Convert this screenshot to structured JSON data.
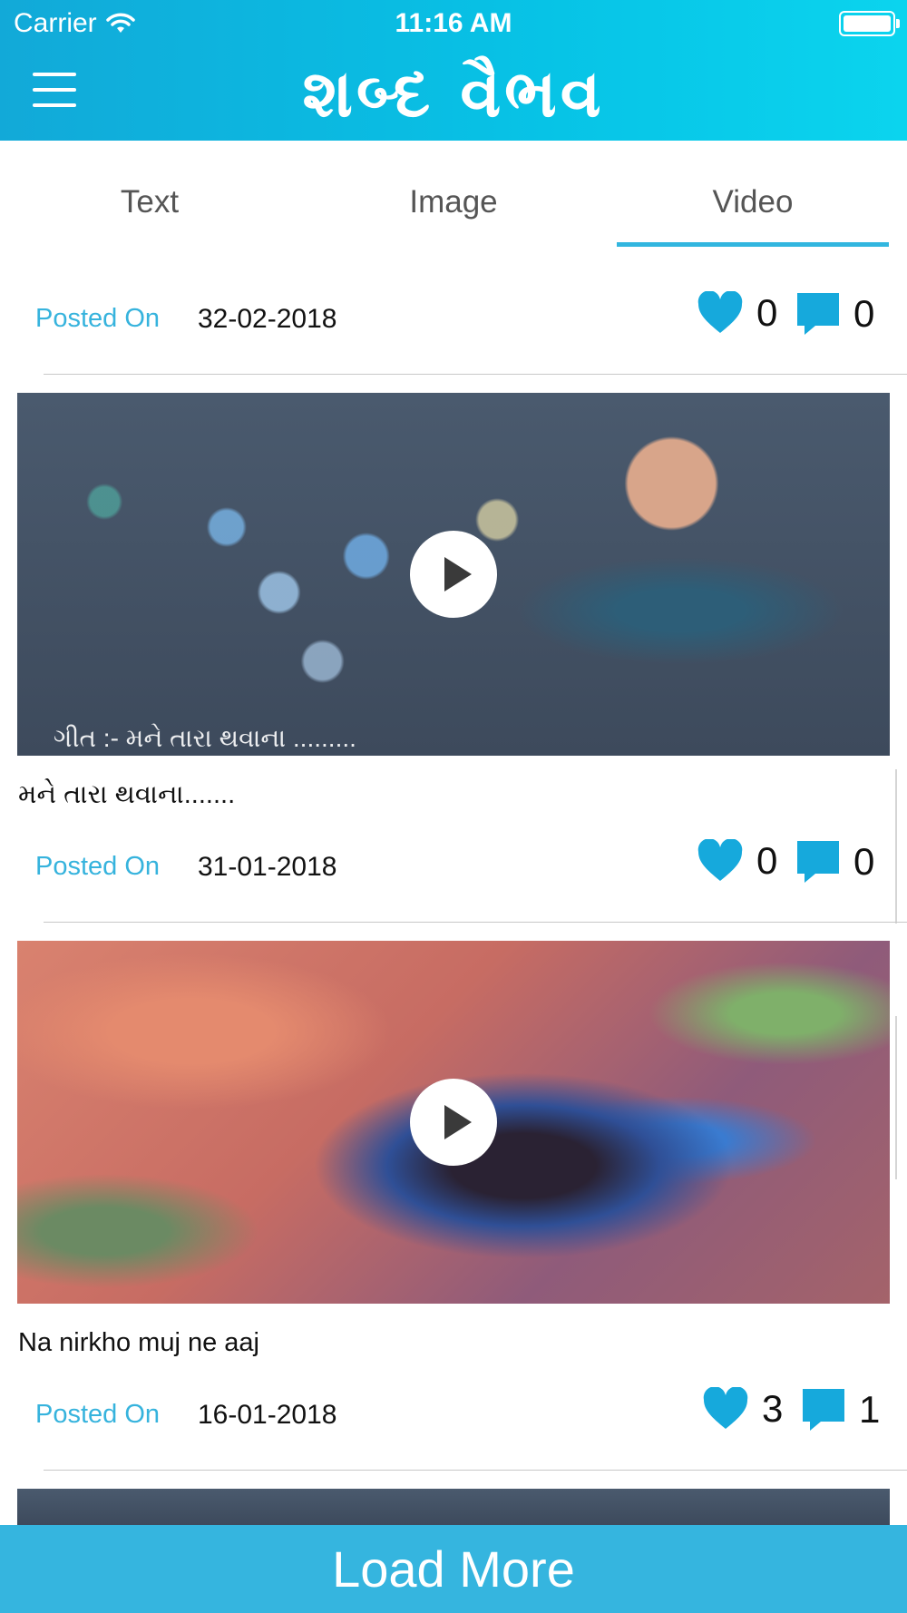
{
  "status_bar": {
    "carrier": "Carrier",
    "time": "11:16 AM"
  },
  "header": {
    "title": "શબ્દ વૈભવ"
  },
  "tabs": [
    {
      "label": "Text"
    },
    {
      "label": "Image"
    },
    {
      "label": "Video",
      "selected": true
    }
  ],
  "colors": {
    "accent": "#35b5df",
    "header": "#07c3e6",
    "text": "#111111"
  },
  "posts": [
    {
      "posted_label": "Posted On",
      "date": "32-02-2018",
      "likes": "0",
      "comments": "0"
    },
    {
      "title": "મને તારા થવાના.......",
      "thumb_caption": "ગીત :- મને તારા થવાના .........",
      "posted_label": "Posted On",
      "date": "31-01-2018",
      "likes": "0",
      "comments": "0"
    },
    {
      "title": "Na nirkho muj ne aaj",
      "posted_label": "Posted On",
      "date": "16-01-2018",
      "likes": "3",
      "comments": "1"
    }
  ],
  "load_more": {
    "label": "Load More"
  }
}
